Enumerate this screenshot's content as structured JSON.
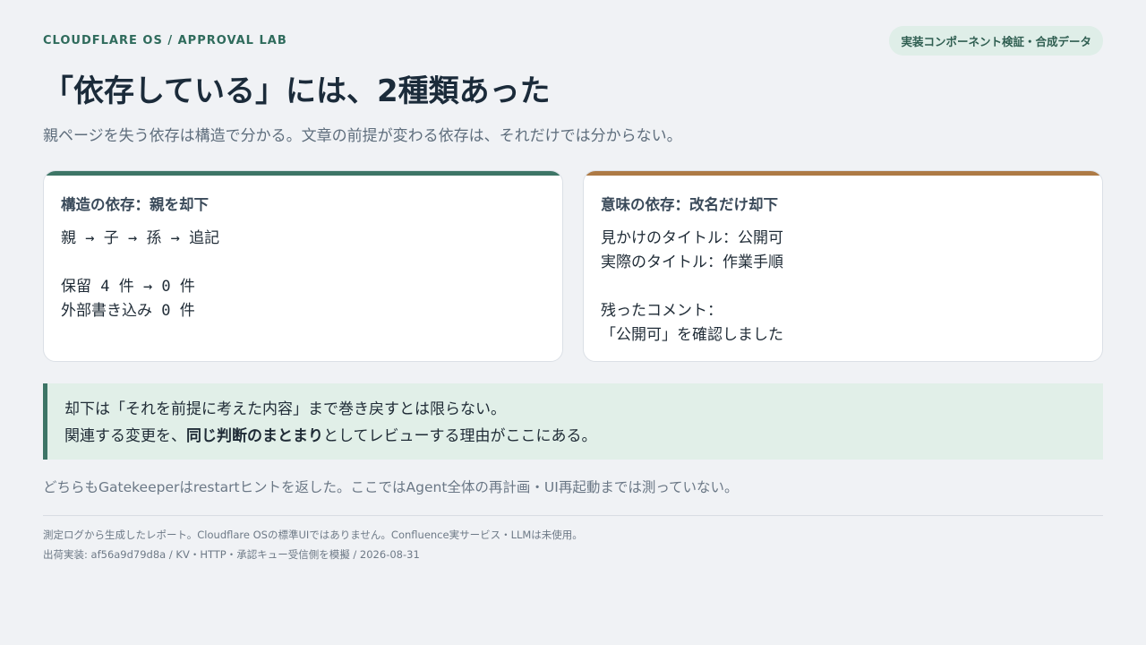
{
  "header": {
    "brand": "CLOUDFLARE OS / APPROVAL LAB",
    "badge": "実装コンポーネント検証・合成データ"
  },
  "title": "「依存している」には、2種類あった",
  "subtitle": "親ページを失う依存は構造で分かる。文章の前提が変わる依存は、それだけでは分からない。",
  "cards": [
    {
      "title": "構造の依存：親を却下",
      "lines": [
        "親 → 子 → 孫 → 追記",
        "",
        "保留 4 件 → 0 件",
        "外部書き込み 0 件"
      ]
    },
    {
      "title": "意味の依存：改名だけ却下",
      "lines": [
        "見かけのタイトル：公開可",
        "実際のタイトル：作業手順",
        "",
        "残ったコメント：",
        "「公開可」を確認しました"
      ]
    }
  ],
  "callout": {
    "line1": "却下は「それを前提に考えた内容」まで巻き戻すとは限らない。",
    "line2_prefix": "関連する変更を、",
    "line2_bold": "同じ判断のまとまり",
    "line2_suffix": "としてレビューする理由がここにある。"
  },
  "note": "どちらもGatekeeperはrestartヒントを返した。ここではAgent全体の再計画・UI再起動までは測っていない。",
  "footer": {
    "line1": "測定ログから生成したレポート。Cloudflare OSの標準UIではありません。Confluence実サービス・LLMは未使用。",
    "line2": "出荷実装: af56a9d79d8a / KV・HTTP・承認キュー受信側を模擬 / 2026-08-31"
  },
  "colors": {
    "accent_green": "#3d7566",
    "accent_brown": "#ad7a45",
    "callout_bg": "#e1efe8",
    "page_bg": "#f0f2f5"
  }
}
